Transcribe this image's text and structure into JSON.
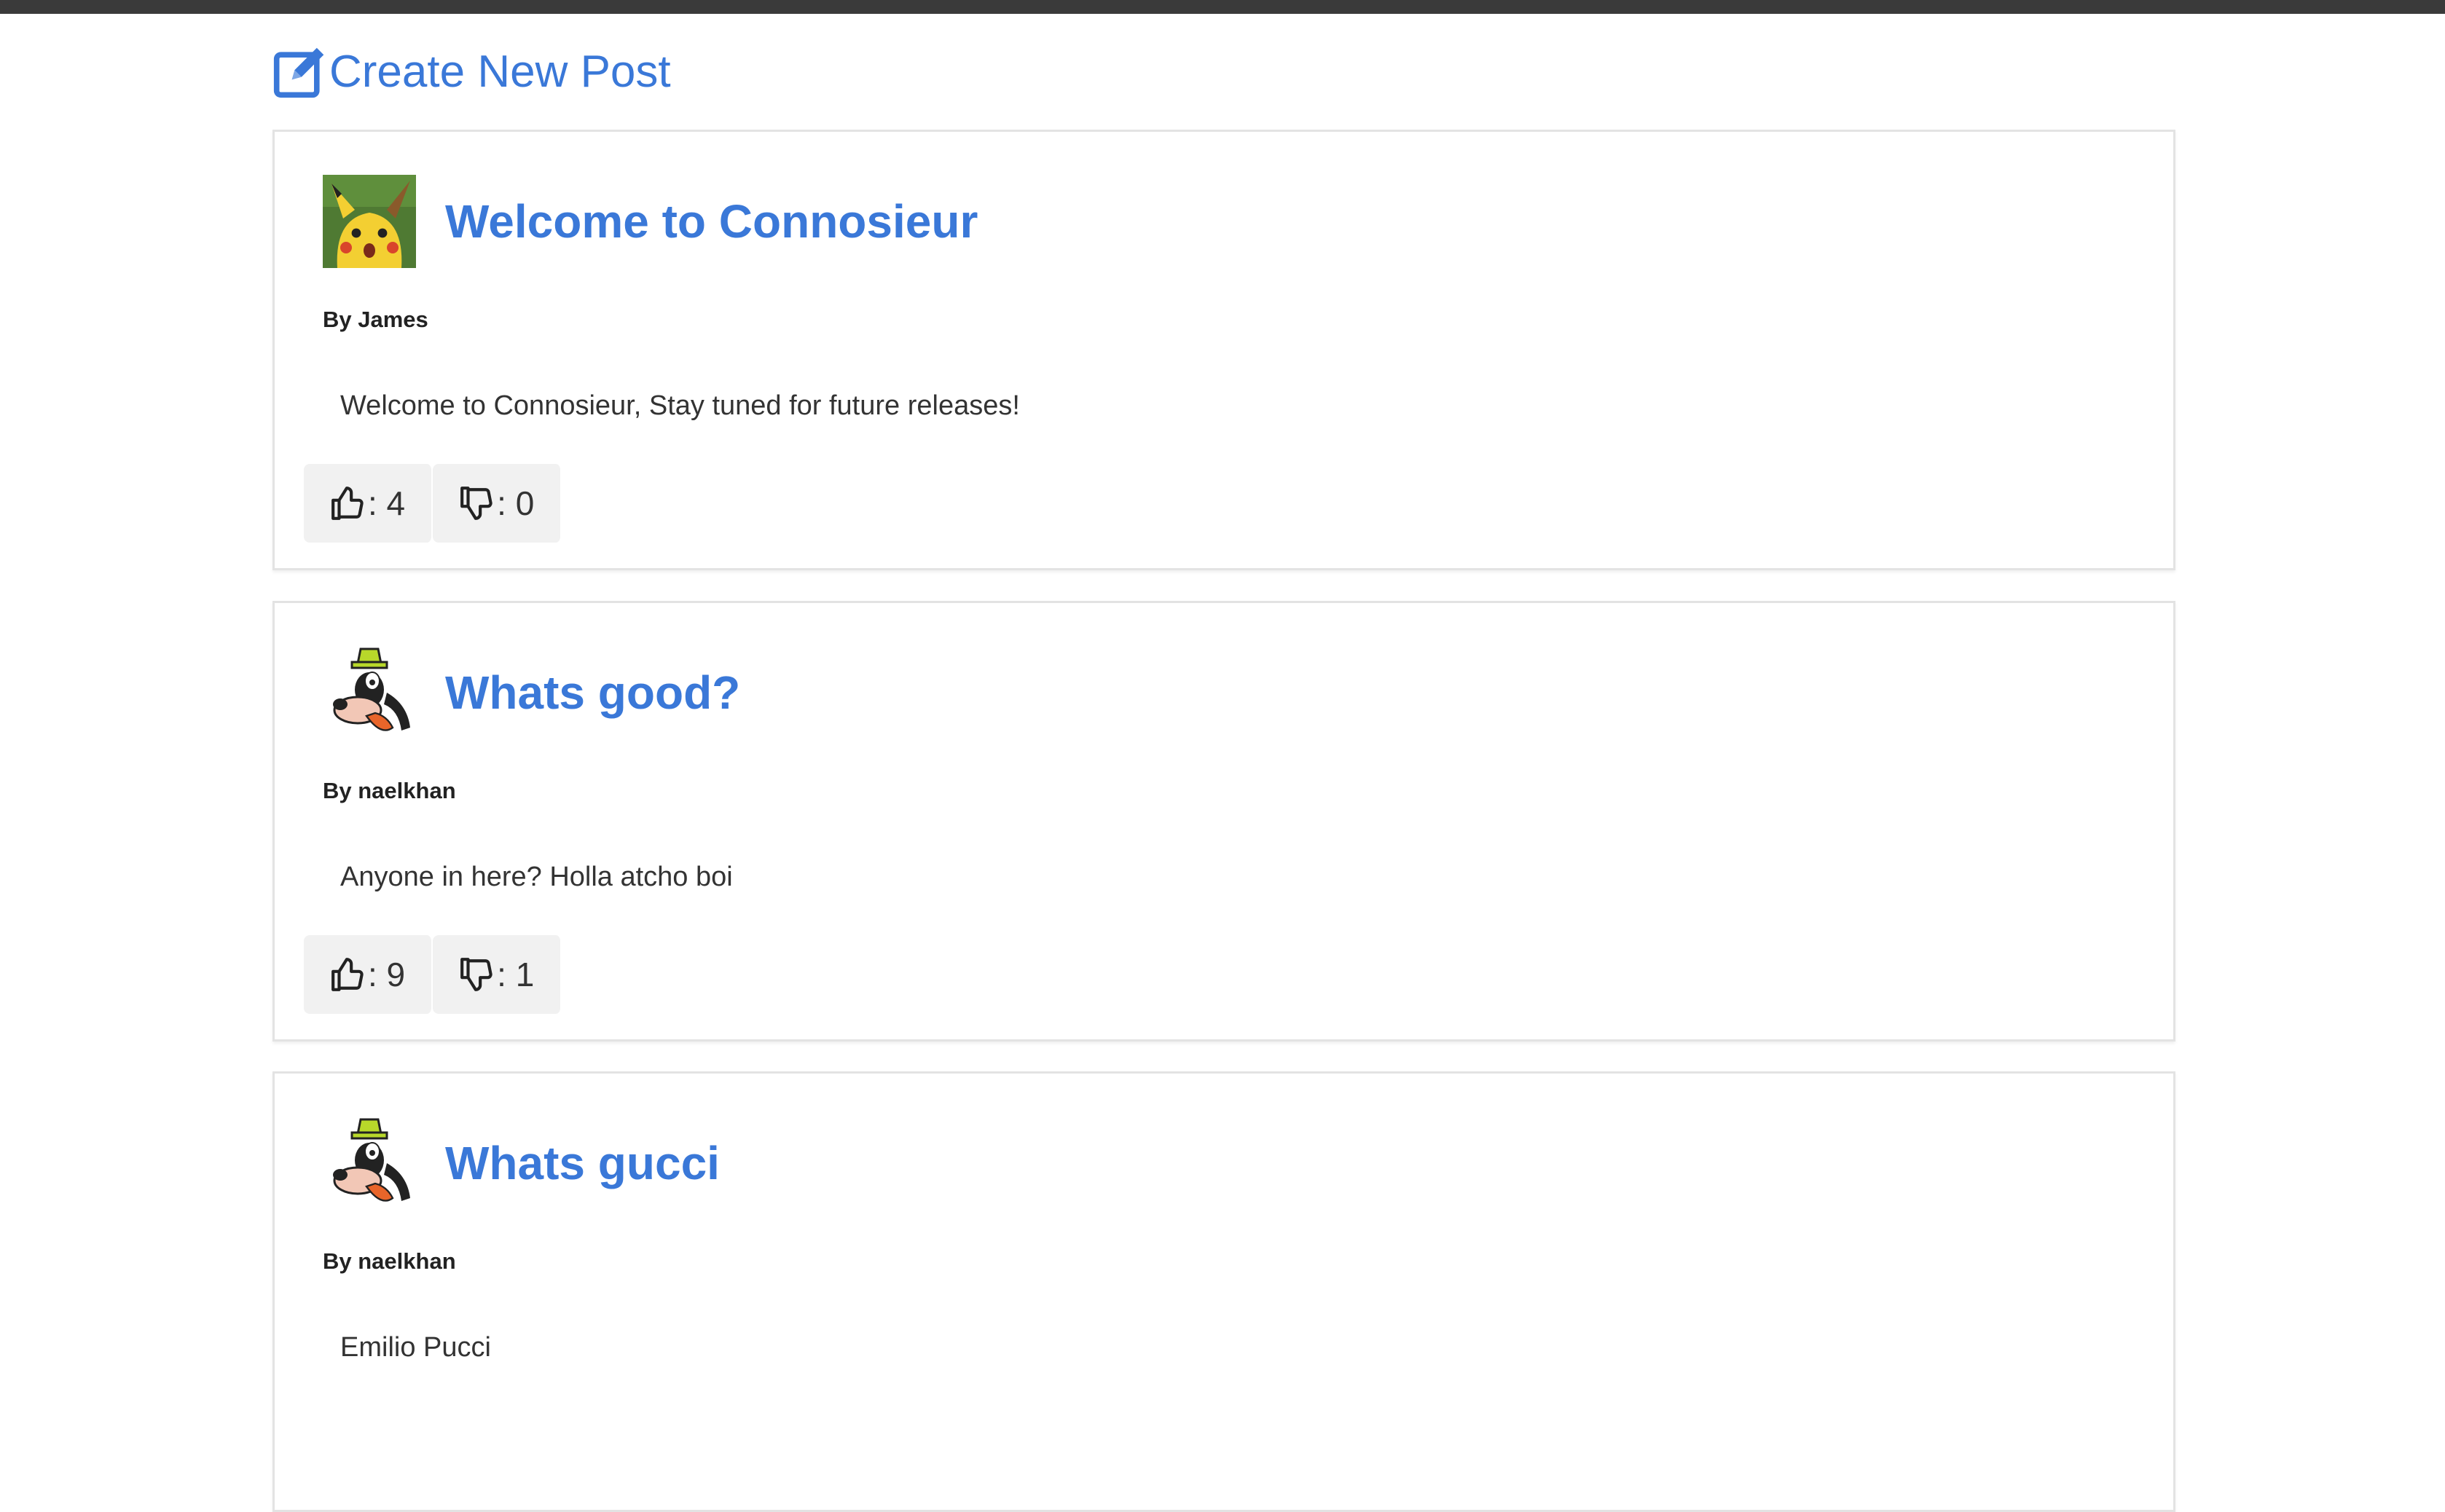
{
  "header": {
    "create_label": "Create New Post",
    "create_icon": "edit-icon",
    "link_color": "#3a78d8"
  },
  "posts": [
    {
      "title": "Welcome to Connosieur",
      "author": "By James",
      "body": "Welcome to Connosieur, Stay tuned for future releases!",
      "likes": ": 4",
      "dislikes": ": 0",
      "avatar": "pikachu-avatar"
    },
    {
      "title": "Whats good?",
      "author": "By naelkhan",
      "body": "Anyone in here? Holla atcho boi",
      "likes": ": 9",
      "dislikes": ": 1",
      "avatar": "goofy-avatar"
    },
    {
      "title": "Whats gucci",
      "author": "By naelkhan",
      "body": "Emilio Pucci",
      "likes": "",
      "dislikes": "",
      "avatar": "goofy-avatar"
    }
  ]
}
